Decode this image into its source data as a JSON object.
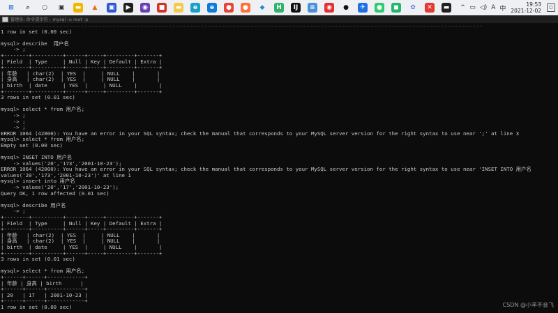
{
  "taskbar": {
    "apps": [
      {
        "name": "start-icon",
        "glyph": "⊞",
        "color": "#1a73e8",
        "fg": "#1a73e8",
        "bg": "transparent"
      },
      {
        "name": "search-icon",
        "glyph": "⌕",
        "color": "#333",
        "fg": "#333",
        "bg": "transparent"
      },
      {
        "name": "cortana-icon",
        "glyph": "○",
        "color": "#333",
        "fg": "#333",
        "bg": "transparent"
      },
      {
        "name": "task-view-icon",
        "glyph": "▣",
        "color": "#333",
        "fg": "#333",
        "bg": "transparent"
      },
      {
        "name": "file-explorer-icon",
        "glyph": "▬",
        "color": "#f2b600",
        "fg": "#fff",
        "bg": "#f2b600"
      },
      {
        "name": "matlab-icon",
        "glyph": "▲",
        "color": "#e86a1a",
        "fg": "#e86a1a",
        "bg": "transparent"
      },
      {
        "name": "screen-capture-icon",
        "glyph": "▣",
        "color": "#2b58d6",
        "fg": "#fff",
        "bg": "#2b58d6"
      },
      {
        "name": "video-icon",
        "glyph": "▶",
        "color": "#1f1f1f",
        "fg": "#fff",
        "bg": "#1f1f1f"
      },
      {
        "name": "obs-icon",
        "glyph": "◉",
        "color": "#6a3fb5",
        "fg": "#fff",
        "bg": "#6a3fb5"
      },
      {
        "name": "app-red-icon",
        "glyph": "■",
        "color": "#d93025",
        "fg": "#fff",
        "bg": "#d93025"
      },
      {
        "name": "folder-icon",
        "glyph": "▬",
        "color": "#f7c948",
        "fg": "#fff",
        "bg": "#f7c948"
      },
      {
        "name": "edge-icon",
        "glyph": "e",
        "color": "#16a085",
        "fg": "#fff",
        "bg": "#1aa0c8"
      },
      {
        "name": "edge-chromium-icon",
        "glyph": "e",
        "color": "#0f7bd8",
        "fg": "#fff",
        "bg": "#0f7bd8"
      },
      {
        "name": "chrome-icon",
        "glyph": "●",
        "color": "#34a853",
        "fg": "#fff",
        "bg": "#ea4335"
      },
      {
        "name": "firefox-icon",
        "glyph": "●",
        "color": "#ff7139",
        "fg": "#fff",
        "bg": "#ff7139"
      },
      {
        "name": "vscode-icon",
        "glyph": "◆",
        "color": "#1f8ad2",
        "fg": "#1f8ad2",
        "bg": "transparent"
      },
      {
        "name": "hbuilder-icon",
        "glyph": "H",
        "color": "#2db36b",
        "fg": "#fff",
        "bg": "#2db36b"
      },
      {
        "name": "idea-icon",
        "glyph": "IJ",
        "color": "#111",
        "fg": "#fff",
        "bg": "#111"
      },
      {
        "name": "notepad-icon",
        "glyph": "≡",
        "color": "#4a90d9",
        "fg": "#fff",
        "bg": "#4a90d9"
      },
      {
        "name": "netease-music-icon",
        "glyph": "◉",
        "color": "#e32f2f",
        "fg": "#fff",
        "bg": "#e32f2f"
      },
      {
        "name": "qq-icon",
        "glyph": "●",
        "color": "#111",
        "fg": "#111",
        "bg": "transparent"
      },
      {
        "name": "feishu-icon",
        "glyph": "✈",
        "color": "#1f6fe5",
        "fg": "#fff",
        "bg": "#1f6fe5"
      },
      {
        "name": "wechat-icon",
        "glyph": "●",
        "color": "#2ecc71",
        "fg": "#fff",
        "bg": "#2ecc71"
      },
      {
        "name": "app-green-icon",
        "glyph": "◼",
        "color": "#1fb86a",
        "fg": "#fff",
        "bg": "#1fb86a"
      },
      {
        "name": "network-app-icon",
        "glyph": "✿",
        "color": "#4d7ee8",
        "fg": "#4d7ee8",
        "bg": "transparent"
      },
      {
        "name": "close-app-icon",
        "glyph": "✕",
        "color": "#e53935",
        "fg": "#fff",
        "bg": "#e53935"
      },
      {
        "name": "terminal-icon",
        "glyph": "▬",
        "color": "#222",
        "fg": "#fff",
        "bg": "#222"
      }
    ],
    "tray": {
      "chevron": "^",
      "network": "▭",
      "volume": "◁)",
      "ime_a": "A",
      "ime_zh": "中",
      "time": "19:53",
      "date": "2021-12-02"
    }
  },
  "window": {
    "title": "管理员: 命令提示符 - mysql  -u root -p"
  },
  "console_lines": [
    {
      "t": "sep",
      "text": ""
    },
    {
      "t": "txt",
      "text": "1 row in set (0.00 sec)"
    },
    {
      "t": "txt",
      "text": ""
    },
    {
      "t": "txt",
      "text": "mysql> describe  用户名"
    },
    {
      "t": "txt",
      "text": "    -> ;"
    },
    {
      "t": "txt",
      "text": "+--------+----------+------+-----+---------+-------+"
    },
    {
      "t": "txt",
      "text": "| Field  | Type     | Null | Key | Default | Extra |"
    },
    {
      "t": "txt",
      "text": "+--------+----------+------+-----+---------+-------+"
    },
    {
      "t": "txt",
      "text": "| 年龄   | char(2)  | YES  |     | NULL    |       |"
    },
    {
      "t": "txt",
      "text": "| 身高   | char(2)  | YES  |     | NULL    |       |"
    },
    {
      "t": "txt",
      "text": "| birth  | date     | YES  |     | NULL    |       |"
    },
    {
      "t": "txt",
      "text": "+--------+----------+------+-----+---------+-------+"
    },
    {
      "t": "txt",
      "text": "3 rows in set (0.01 sec)"
    },
    {
      "t": "txt",
      "text": ""
    },
    {
      "t": "txt",
      "text": "mysql> select * from 用户名;"
    },
    {
      "t": "txt",
      "text": "    -> ;"
    },
    {
      "t": "txt",
      "text": "    -> ;"
    },
    {
      "t": "txt",
      "text": "    -> ;"
    },
    {
      "t": "txt",
      "text": "ERROR 1064 (42000): You have an error in your SQL syntax; check the manual that corresponds to your MySQL server version for the right syntax to use near ';' at line 3"
    },
    {
      "t": "txt",
      "text": "mysql> select * from 用户名;"
    },
    {
      "t": "txt",
      "text": "Empty set (0.00 sec)"
    },
    {
      "t": "txt",
      "text": ""
    },
    {
      "t": "txt",
      "text": "mysql> INSET INTO 用户名"
    },
    {
      "t": "txt",
      "text": "    -> values('20','173','2001-10-23');"
    },
    {
      "t": "txt",
      "text": "ERROR 1064 (42000): You have an error in your SQL syntax; check the manual that corresponds to your MySQL server version for the right syntax to use near 'INSET INTO 用户名"
    },
    {
      "t": "txt",
      "text": "values('20','173','2001-10-23')' at line 1"
    },
    {
      "t": "txt",
      "text": "mysql> insert into 用户名"
    },
    {
      "t": "txt",
      "text": "    -> values('20','17','2001-10-23');"
    },
    {
      "t": "txt",
      "text": "Query OK, 1 row affected (0.01 sec)"
    },
    {
      "t": "txt",
      "text": ""
    },
    {
      "t": "txt",
      "text": "mysql> describe 用户名"
    },
    {
      "t": "txt",
      "text": "    -> ;"
    },
    {
      "t": "txt",
      "text": "+--------+----------+------+-----+---------+-------+"
    },
    {
      "t": "txt",
      "text": "| Field  | Type     | Null | Key | Default | Extra |"
    },
    {
      "t": "txt",
      "text": "+--------+----------+------+-----+---------+-------+"
    },
    {
      "t": "txt",
      "text": "| 年龄   | char(2)  | YES  |     | NULL    |       |"
    },
    {
      "t": "txt",
      "text": "| 身高   | char(2)  | YES  |     | NULL    |       |"
    },
    {
      "t": "txt",
      "text": "| birth  | date     | YES  |     | NULL    |       |"
    },
    {
      "t": "txt",
      "text": "+--------+----------+------+-----+---------+-------+"
    },
    {
      "t": "txt",
      "text": "3 rows in set (0.01 sec)"
    },
    {
      "t": "txt",
      "text": ""
    },
    {
      "t": "txt",
      "text": "mysql> select * from 用户名;"
    },
    {
      "t": "txt",
      "text": "+------+------+------------+"
    },
    {
      "t": "txt",
      "text": "| 年龄 | 身高 | birth      |"
    },
    {
      "t": "txt",
      "text": "+------+------+------------+"
    },
    {
      "t": "txt",
      "text": "| 20   | 17   | 2001-10-23 |"
    },
    {
      "t": "txt",
      "text": "+------+------+------------+"
    },
    {
      "t": "txt",
      "text": "1 row in set (0.00 sec)"
    },
    {
      "t": "txt",
      "text": ""
    },
    {
      "t": "txt",
      "text": "mysql>"
    }
  ],
  "watermark": "CSDN @小羊不会飞"
}
